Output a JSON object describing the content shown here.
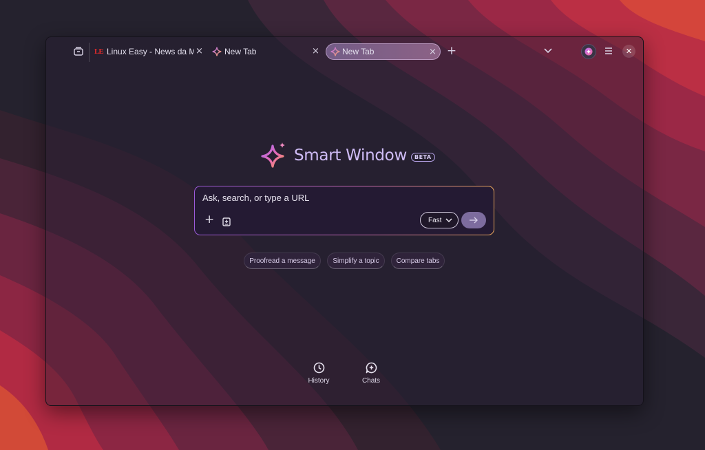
{
  "tabs": [
    {
      "label": "Linux Easy - News da Mondo Linux",
      "favicon": "LE",
      "active": false
    },
    {
      "label": "New Tab",
      "icon": "smart-window-sparkle-icon",
      "active": false
    },
    {
      "label": "New Tab",
      "icon": "smart-window-sparkle-icon",
      "active": true
    }
  ],
  "tabbar": {
    "close_glyph": "×",
    "new_tab_glyph": "+",
    "close_window_glyph": "✕"
  },
  "brand": {
    "title": "Smart Window",
    "badge": "BETA"
  },
  "prompt": {
    "placeholder": "Ask, search, or type a URL",
    "add_glyph": "+",
    "model": "Fast"
  },
  "suggestions": [
    "Proofread a message",
    "Simplify a topic",
    "Compare tabs"
  ],
  "bottom_actions": [
    {
      "label": "History",
      "icon": "clock-icon"
    },
    {
      "label": "Chats",
      "icon": "chat-add-icon"
    }
  ],
  "colors": {
    "accent": "#cfbcf6",
    "favicon_red": "#e02b2b",
    "wallpaper_red": "#b52a4a",
    "wallpaper_dark": "#25222e"
  }
}
